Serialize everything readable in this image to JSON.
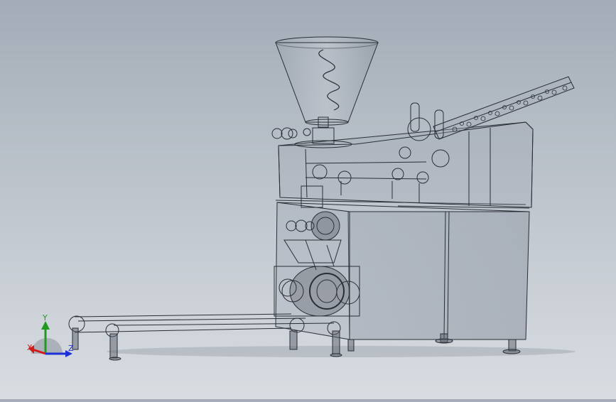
{
  "viewport": {
    "background_top": "#a3acb7",
    "background_bottom": "#d9dde2",
    "model_line_color": "#2a2e36",
    "model_fill_color": "#8f98a6"
  },
  "triad": {
    "x_label": "X",
    "y_label": "Y",
    "z_label": "Z",
    "x_color": "#d11b1b",
    "y_color": "#1f9a1f",
    "z_color": "#1d2fd6"
  }
}
